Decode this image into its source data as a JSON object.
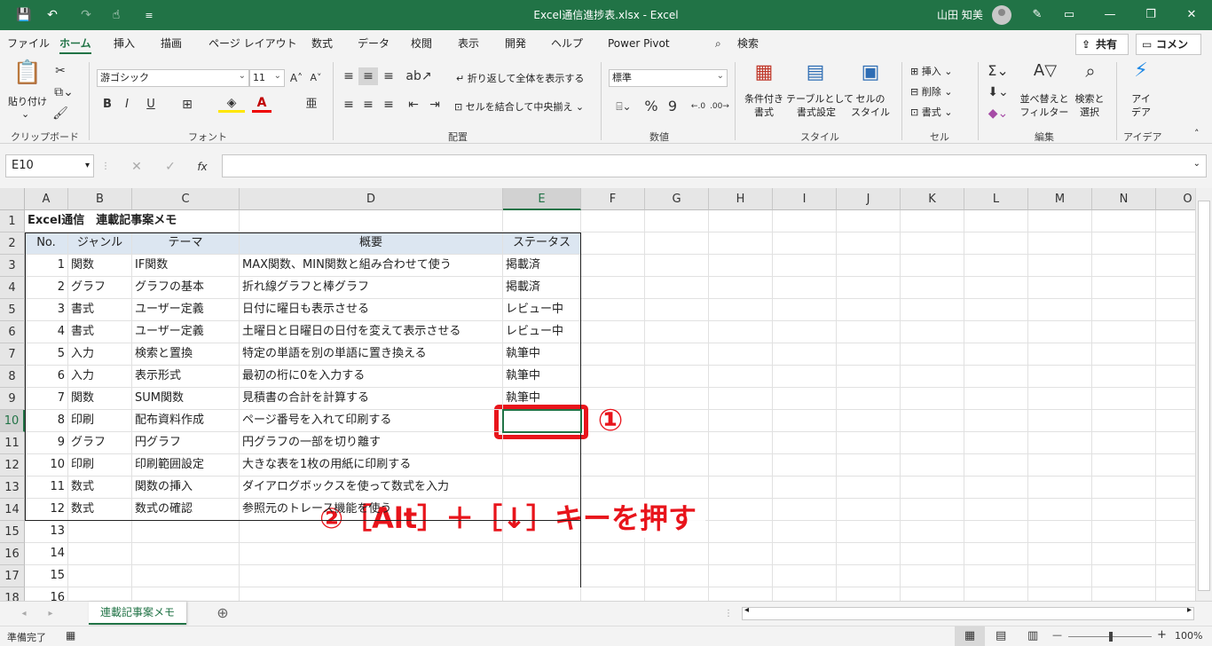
{
  "titlebar": {
    "title": "Excel通信進捗表.xlsx  -  Excel",
    "user": "山田 知美",
    "save_icon": "💾",
    "undo_icon": "↶",
    "redo_icon": "↷",
    "touch_icon": "☝",
    "customize_icon": "≡",
    "pen_icon": "✎",
    "ribbon_display_icon": "▭",
    "minimize": "—",
    "restore": "❐",
    "close": "✕"
  },
  "menu": {
    "tabs": [
      "ファイル",
      "ホーム",
      "挿入",
      "描画",
      "ページ レイアウト",
      "数式",
      "データ",
      "校閲",
      "表示",
      "開発",
      "ヘルプ",
      "Power Pivot"
    ],
    "search": "検索",
    "share": "共有",
    "comment": "コメント"
  },
  "ribbon": {
    "clipboard": {
      "paste": "貼り付け",
      "label": "クリップボード"
    },
    "font": {
      "name": "游ゴシック",
      "size": "11",
      "bold": "B",
      "italic": "I",
      "underline": "U",
      "label": "フォント",
      "grow": "A˄",
      "shrink": "A˅"
    },
    "alignment": {
      "wrap": "折り返して全体を表示する",
      "merge": "セルを結合して中央揃え",
      "label": "配置"
    },
    "number": {
      "format": "標準",
      "percent": "%",
      "comma": "9",
      "label": "数値"
    },
    "styles": {
      "conditional": [
        "条件付き",
        "書式"
      ],
      "table": [
        "テーブルとして",
        "書式設定"
      ],
      "cellstyle": [
        "セルの",
        "スタイル"
      ],
      "label": "スタイル"
    },
    "cells": {
      "insert": "挿入",
      "delete": "削除",
      "format": "書式",
      "label": "セル"
    },
    "editing": {
      "sum": "Σ",
      "sort": [
        "並べ替えと",
        "フィルター"
      ],
      "find": [
        "検索と",
        "選択"
      ],
      "label": "編集"
    },
    "ideas": {
      "name": [
        "アイ",
        "デア"
      ],
      "label": "アイデア"
    }
  },
  "formula_bar": {
    "name_box": "E10",
    "fx": "fx",
    "cancel": "✕",
    "enter": "✓",
    "value": ""
  },
  "columns": [
    "A",
    "B",
    "C",
    "D",
    "E",
    "F",
    "G",
    "H",
    "I",
    "J",
    "K",
    "L",
    "M",
    "N",
    "O"
  ],
  "rows": [
    "1",
    "2",
    "3",
    "4",
    "5",
    "6",
    "7",
    "8",
    "9",
    "10",
    "11",
    "12",
    "13",
    "14",
    "15",
    "16",
    "17",
    "18"
  ],
  "sheet": {
    "title": "Excel通信　連載記事案メモ",
    "headers": [
      "No.",
      "ジャンル",
      "テーマ",
      "概要",
      "ステータス"
    ],
    "records": [
      [
        "1",
        "関数",
        "IF関数",
        "MAX関数、MIN関数と組み合わせて使う",
        "掲載済"
      ],
      [
        "2",
        "グラフ",
        "グラフの基本",
        "折れ線グラフと棒グラフ",
        "掲載済"
      ],
      [
        "3",
        "書式",
        "ユーザー定義",
        "日付に曜日も表示させる",
        "レビュー中"
      ],
      [
        "4",
        "書式",
        "ユーザー定義",
        "土曜日と日曜日の日付を変えて表示させる",
        "レビュー中"
      ],
      [
        "5",
        "入力",
        "検索と置換",
        "特定の単語を別の単語に置き換える",
        "執筆中"
      ],
      [
        "6",
        "入力",
        "表示形式",
        "最初の桁に0を入力する",
        "執筆中"
      ],
      [
        "7",
        "関数",
        "SUM関数",
        "見積書の合計を計算する",
        "執筆中"
      ],
      [
        "8",
        "印刷",
        "配布資料作成",
        "ページ番号を入れて印刷する",
        ""
      ],
      [
        "9",
        "グラフ",
        "円グラフ",
        "円グラフの一部を切り離す",
        ""
      ],
      [
        "10",
        "印刷",
        "印刷範囲設定",
        "大きな表を1枚の用紙に印刷する",
        ""
      ],
      [
        "11",
        "数式",
        "関数の挿入",
        "ダイアログボックスを使って数式を入力",
        ""
      ],
      [
        "12",
        "数式",
        "数式の確認",
        "参照元のトレース機能を使う",
        ""
      ],
      [
        "13",
        "",
        "",
        "",
        ""
      ],
      [
        "14",
        "",
        "",
        "",
        ""
      ],
      [
        "15",
        "",
        "",
        "",
        ""
      ],
      [
        "16",
        "",
        "",
        "",
        ""
      ]
    ]
  },
  "annotations": {
    "step1": "①",
    "step2": "②［Alt］＋［↓］キーを押す",
    "highlight_color": "#e8141b"
  },
  "sheet_tabs": {
    "active": "連載記事案メモ",
    "add": "⊕"
  },
  "status": {
    "ready": "準備完了",
    "zoom": "100%"
  },
  "colors": {
    "accent": "#217346",
    "header_fill": "#dce6f1"
  }
}
